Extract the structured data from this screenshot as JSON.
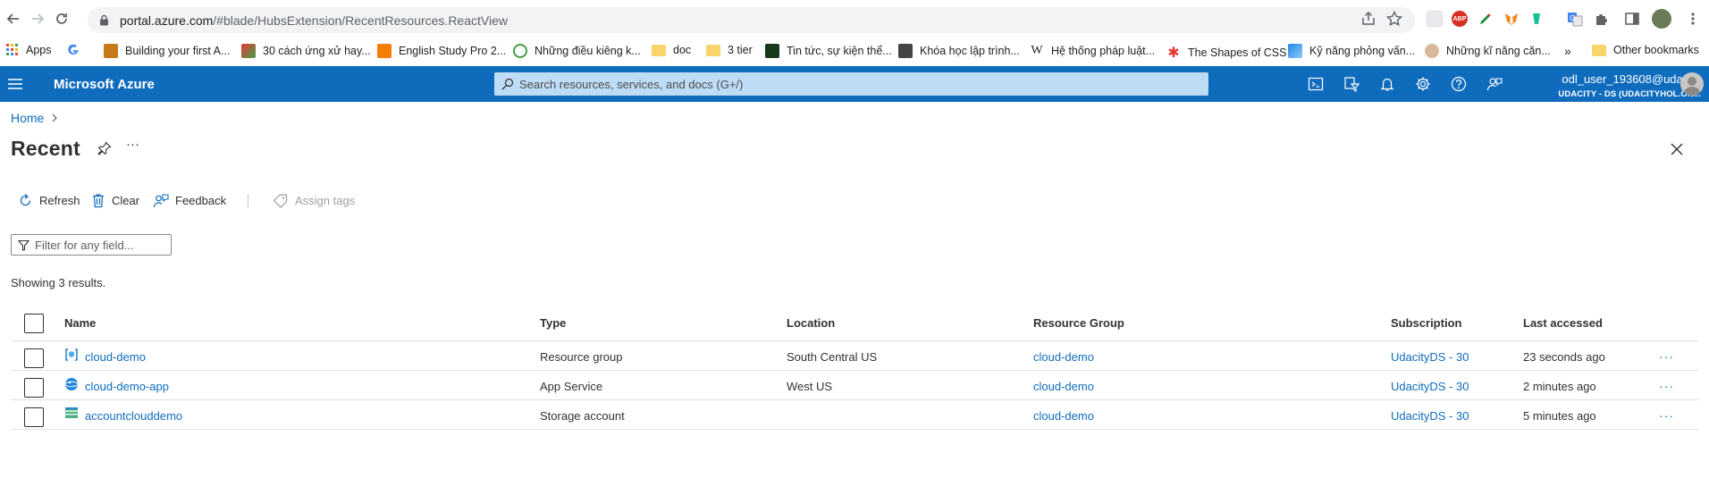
{
  "browser": {
    "url_host": "portal.azure.com",
    "url_path": "/#blade/HubsExtension/RecentResources.ReactView",
    "bookmarks": [
      {
        "label": "Apps",
        "icon": "apps-grid-icon"
      },
      {
        "label": "",
        "icon": "google-icon"
      },
      {
        "label": "Building your first A...",
        "icon": "bookmark-favicon"
      },
      {
        "label": "30 cách ứng xử hay...",
        "icon": "bookmark-favicon"
      },
      {
        "label": "English Study Pro 2...",
        "icon": "blogger-icon"
      },
      {
        "label": "Những điều kiêng k...",
        "icon": "bookmark-favicon"
      },
      {
        "label": "doc",
        "icon": "folder-icon"
      },
      {
        "label": "3 tier",
        "icon": "folder-icon"
      },
      {
        "label": "Tin tức, sự kiện thể...",
        "icon": "bookmark-favicon"
      },
      {
        "label": "Khóa học lập trình...",
        "icon": "bookmark-favicon"
      },
      {
        "label": "Hệ thống pháp luật...",
        "icon": "wikipedia-icon"
      },
      {
        "label": "The Shapes of CSS",
        "icon": "css-icon"
      },
      {
        "label": "Kỹ năng phỏng vấn...",
        "icon": "bookmark-favicon"
      },
      {
        "label": "Những kĩ năng căn...",
        "icon": "bookmark-favicon"
      },
      {
        "label": "»",
        "icon": "overflow-chevron"
      },
      {
        "label": "Other bookmarks",
        "icon": "folder-icon"
      }
    ]
  },
  "azure": {
    "brand": "Microsoft Azure",
    "search_placeholder": "Search resources, services, and docs (G+/)",
    "user": "odl_user_193608@udaci...",
    "directory": "UDACITY - DS (UDACITYHOL.ON..."
  },
  "page": {
    "breadcrumb_home": "Home",
    "title": "Recent",
    "more": "···",
    "commands": {
      "refresh": "Refresh",
      "clear": "Clear",
      "feedback": "Feedback",
      "assign_tags": "Assign tags"
    },
    "filter_placeholder": "Filter for any field...",
    "result_count": "Showing 3 results."
  },
  "table": {
    "columns": {
      "name": "Name",
      "type": "Type",
      "location": "Location",
      "resource_group": "Resource Group",
      "subscription": "Subscription",
      "last_accessed": "Last accessed"
    },
    "rows": [
      {
        "name": "cloud-demo",
        "icon": "resource-group-icon",
        "type": "Resource group",
        "location": "South Central US",
        "resource_group": "cloud-demo",
        "subscription": "UdacityDS - 30",
        "last_accessed": "23 seconds ago",
        "more": "···"
      },
      {
        "name": "cloud-demo-app",
        "icon": "app-service-icon",
        "type": "App Service",
        "location": "West US",
        "resource_group": "cloud-demo",
        "subscription": "UdacityDS - 30",
        "last_accessed": "2 minutes ago",
        "more": "···"
      },
      {
        "name": "accountclouddemo",
        "icon": "storage-account-icon",
        "type": "Storage account",
        "location": "",
        "resource_group": "cloud-demo",
        "subscription": "UdacityDS - 30",
        "last_accessed": "5 minutes ago",
        "more": "···"
      }
    ]
  },
  "colors": {
    "azure_blue": "#0f6cbd",
    "search_bg": "#bfdcf6",
    "link": "#0f6cbd"
  }
}
